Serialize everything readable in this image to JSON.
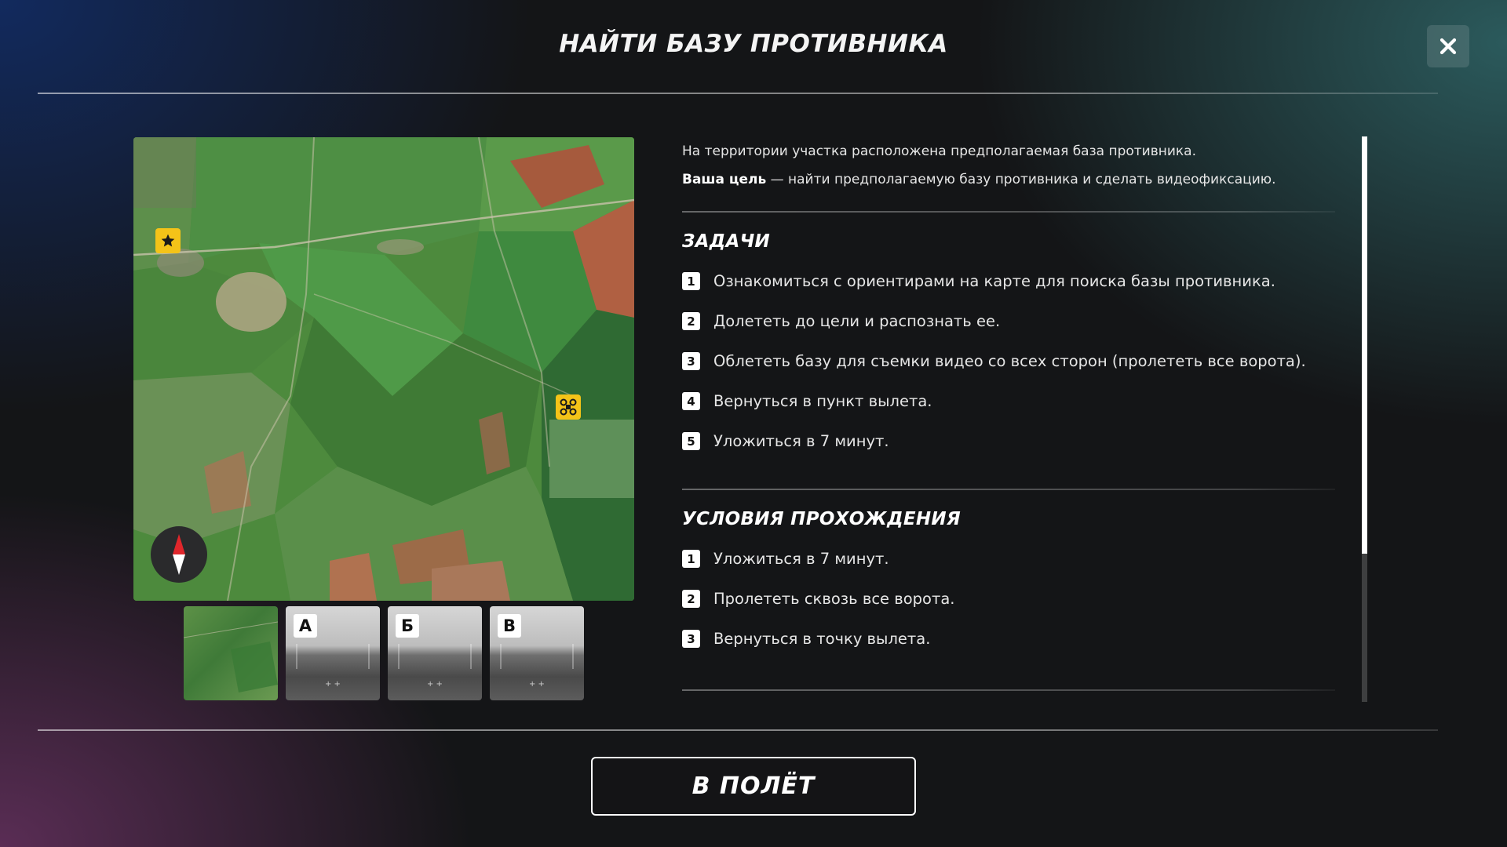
{
  "header": {
    "title": "НАЙТИ БАЗУ ПРОТИВНИКА",
    "close_icon": "close-icon"
  },
  "map": {
    "markers": [
      {
        "icon": "star-icon",
        "color": "#f4c318"
      },
      {
        "icon": "drone-icon",
        "color": "#f4c318"
      }
    ],
    "compass_icon": "compass-icon"
  },
  "thumbnails": [
    {
      "type": "map",
      "tag": ""
    },
    {
      "type": "camera",
      "tag": "А"
    },
    {
      "type": "camera",
      "tag": "Б"
    },
    {
      "type": "camera",
      "tag": "В"
    }
  ],
  "intro": {
    "line1": "На территории участка расположена предполагаемая база противника.",
    "goal_bold": "Ваша цель",
    "goal_rest": " — найти предполагаемую базу противника и сделать видеофиксацию."
  },
  "tasks": {
    "title": "ЗАДАЧИ",
    "items": [
      {
        "n": "1",
        "text": "Ознакомиться с ориентирами на карте для поиска базы противника."
      },
      {
        "n": "2",
        "text": "Долететь до цели и распознать ее."
      },
      {
        "n": "3",
        "text": "Облететь базу для съемки видео со всех сторон (пролететь все ворота)."
      },
      {
        "n": "4",
        "text": "Вернуться в пункт вылета."
      },
      {
        "n": "5",
        "text": "Уложиться в 7 минут."
      }
    ]
  },
  "conditions": {
    "title": "УСЛОВИЯ ПРОХОЖДЕНИЯ",
    "items": [
      {
        "n": "1",
        "text": "Уложиться в 7 минут."
      },
      {
        "n": "2",
        "text": "Пролететь сквозь все ворота."
      },
      {
        "n": "3",
        "text": "Вернуться в точку вылета."
      }
    ]
  },
  "footer": {
    "fly_label": "В ПОЛЁТ"
  },
  "colors": {
    "accent_yellow": "#f4c318",
    "compass_red": "#e0262b"
  }
}
